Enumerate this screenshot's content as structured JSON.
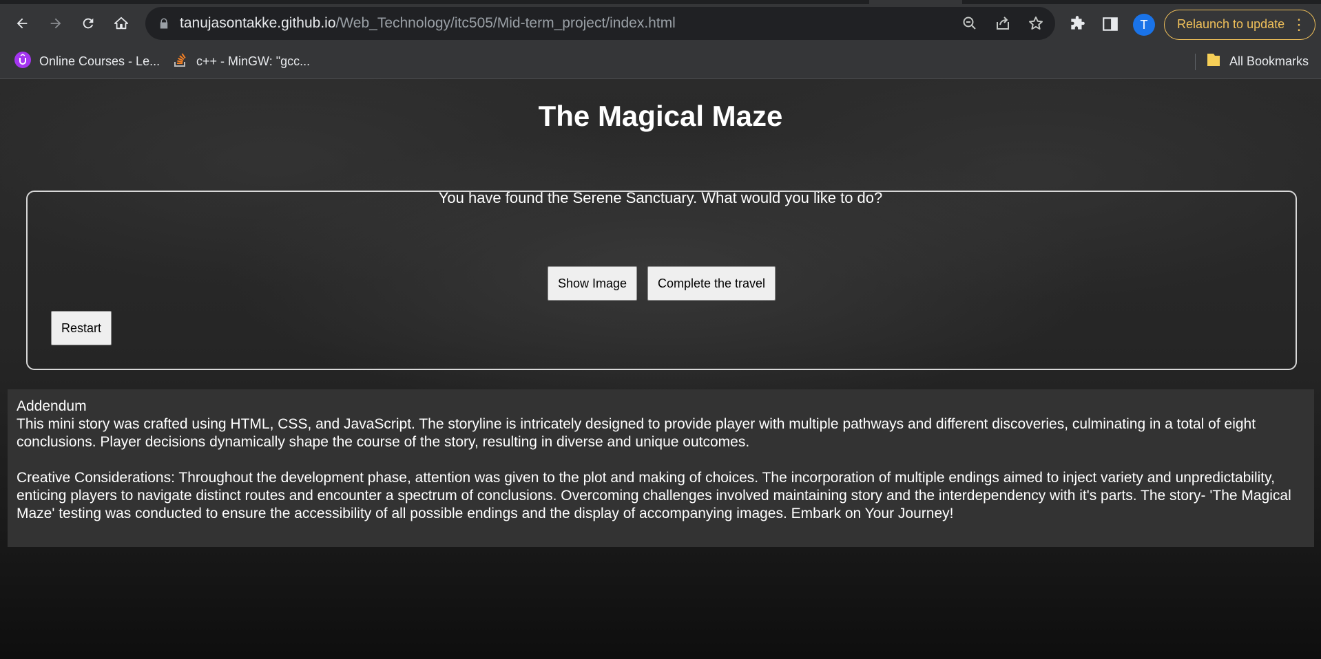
{
  "browser": {
    "url_host": "tanujasontakke.github.io",
    "url_path": "/Web_Technology/itc505/Mid-term_project/index.html",
    "profile_initial": "T",
    "relaunch_label": "Relaunch to update",
    "bookmarks": [
      {
        "label": "Online Courses - Le..."
      },
      {
        "label": "c++ - MinGW: \"gcc..."
      }
    ],
    "all_bookmarks_label": "All Bookmarks",
    "accent_color": "#f1c15a"
  },
  "page": {
    "title": "The Magical Maze",
    "story_text": "You have found the Serene Sanctuary. What would you like to do?",
    "buttons": {
      "show_image": "Show Image",
      "complete_travel": "Complete the travel",
      "restart": "Restart"
    },
    "addendum": {
      "heading": "Addendum",
      "paragraph1": "This mini story was crafted using HTML, CSS, and JavaScript. The storyline is intricately designed to provide player with multiple pathways and different discoveries, culminating in a total of eight conclusions. Player decisions dynamically shape the course of the story, resulting in diverse and unique outcomes.",
      "paragraph2": "Creative Considerations: Throughout the development phase, attention was given to the plot and making of choices. The incorporation of multiple endings aimed to inject variety and unpredictability, enticing players to navigate distinct routes and encounter a spectrum of conclusions. Overcoming challenges involved maintaining story and the interdependency with it's parts. The story- 'The Magical Maze' testing was conducted to ensure the accessibility of all possible endings and the display of accompanying images. Embark on Your Journey!"
    }
  }
}
